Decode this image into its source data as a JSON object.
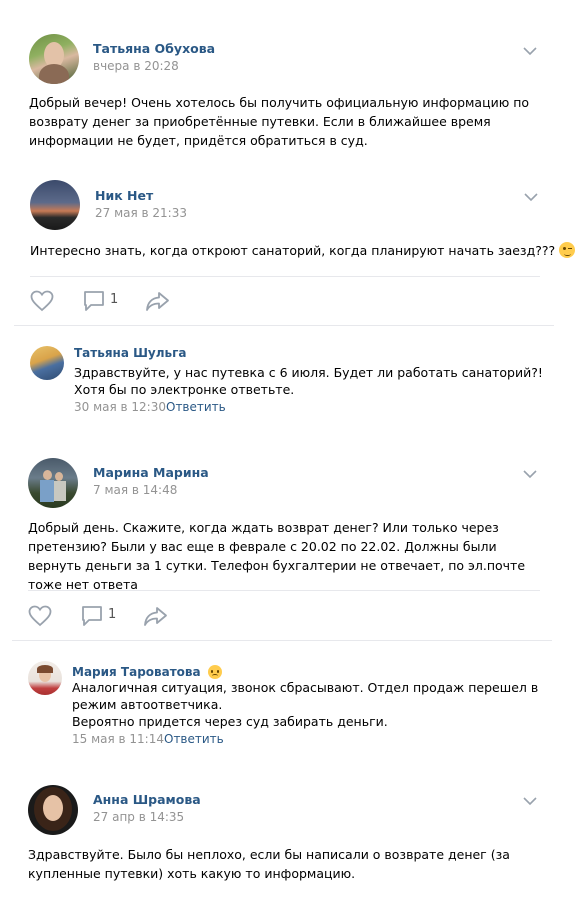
{
  "posts": [
    {
      "author": "Татьяна Обухова",
      "date": "вчера в 20:28",
      "text": "Добрый вечер! Очень хотелось бы получить официальную информацию по возврату денег за приобретённые путевки. Если в ближайшее время информации не будет, придётся обратиться в суд."
    },
    {
      "author": "Ник Нет",
      "date": "27 мая в 21:33",
      "text": "Интересно знать, когда откроют санаторий, когда планируют начать заезд???",
      "comments_count": "1",
      "reply": {
        "author": "Татьяна Шульга",
        "text": "Здравствуйте, у нас путевка с 6 июля. Будет ли работать санаторий?! Хотя бы по электронке ответьте.",
        "date": "30 мая в 12:30",
        "reply_label": "Ответить"
      }
    },
    {
      "author": "Марина Марина",
      "date": "7 мая в 14:48",
      "text": "Добрый день. Скажите, когда ждать возврат денег? Или только через претензию? Были у вас еще в феврале с 20.02 по 22.02. Должны были вернуть деньги за 1 сутки. Телефон бухгалтерии не отвечает, по эл.почте тоже нет ответа",
      "comments_count": "1",
      "reply": {
        "author": "Мария Тароватова",
        "text_line1": "Аналогичная ситуация, звонок сбрасывают. Отдел продаж перешел в режим автоответчика.",
        "text_line2": "Вероятно придется через суд забирать деньги.",
        "date": "15 мая в 11:14",
        "reply_label": "Ответить"
      }
    },
    {
      "author": "Анна Шрамова",
      "date": "27 апр в 14:35",
      "text": "Здравствуйте. Было бы неплохо, если бы написали о возврате денег (за купленные путевки) хоть какую то информацию."
    }
  ],
  "icons": {
    "chevron": "chevron-down-icon",
    "like": "heart-icon",
    "comment": "comment-icon",
    "share": "share-icon",
    "emoji_wink": "winking-face-emoji",
    "emoji_sad": "sad-face-emoji"
  },
  "colors": {
    "name": "#2a5885",
    "date": "#939393",
    "divider": "#e7e8ec",
    "icon": "#99a2ad"
  }
}
